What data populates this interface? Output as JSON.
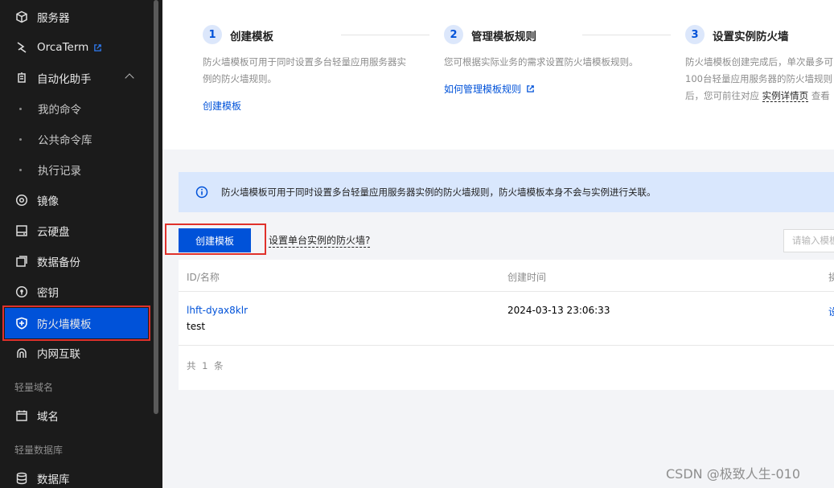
{
  "sidebar": {
    "items": [
      {
        "label": "服务器",
        "icon": "cube-icon"
      },
      {
        "label": "OrcaTerm",
        "icon": "terminal-icon",
        "external": true
      },
      {
        "label": "自动化助手",
        "icon": "automation-icon",
        "expanded": true
      },
      {
        "label": "我的命令",
        "sub": true
      },
      {
        "label": "公共命令库",
        "sub": true
      },
      {
        "label": "执行记录",
        "sub": true
      },
      {
        "label": "镜像",
        "icon": "image-disc-icon"
      },
      {
        "label": "云硬盘",
        "icon": "disk-icon"
      },
      {
        "label": "数据备份",
        "icon": "backup-icon"
      },
      {
        "label": "密钥",
        "icon": "key-icon"
      },
      {
        "label": "防火墙模板",
        "icon": "shield-icon",
        "active": true
      },
      {
        "label": "内网互联",
        "icon": "network-icon"
      },
      {
        "label": "域名",
        "icon": "domain-icon"
      },
      {
        "label": "数据库",
        "icon": "database-icon"
      }
    ],
    "groups": [
      "轻量域名",
      "轻量数据库"
    ]
  },
  "steps": [
    {
      "num": "1",
      "title": "创建模板",
      "desc": "防火墙模板可用于同时设置多台轻量应用服务器实例的防火墙规则。",
      "link": "创建模板"
    },
    {
      "num": "2",
      "title": "管理模板规则",
      "desc": "您可根据实际业务的需求设置防火墙模板规则。",
      "link": "如何管理模板规则"
    },
    {
      "num": "3",
      "title": "设置实例防火墙",
      "desc_line1": "防火墙模板创建完成后，单次最多可",
      "desc_line2": "100台轻量应用服务器的防火墙规则",
      "desc_line3_pre": "后，您可前往对应",
      "desc_line3_link": "实例详情页",
      "desc_line3_post": "查看"
    }
  ],
  "notice": {
    "text": "防火墙模板可用于同时设置多台轻量应用服务器实例的防火墙规则，防火墙模板本身不会与实例进行关联。"
  },
  "toolbar": {
    "create_label": "创建模板",
    "help_link": "设置单台实例的防火墙?",
    "search_placeholder": "请输入模板"
  },
  "table": {
    "headers": [
      "ID/名称",
      "创建时间",
      "操"
    ],
    "rows": [
      {
        "id": "lhft-dyax8klr",
        "name": "test",
        "created": "2024-03-13 23:06:33",
        "action": "设"
      }
    ],
    "footer": "共 1 条"
  },
  "watermark": "CSDN @极致人生-010",
  "colors": {
    "accent": "#0052d9",
    "highlight_box": "#e0312b",
    "sidebar_bg": "#1b1b1b"
  }
}
